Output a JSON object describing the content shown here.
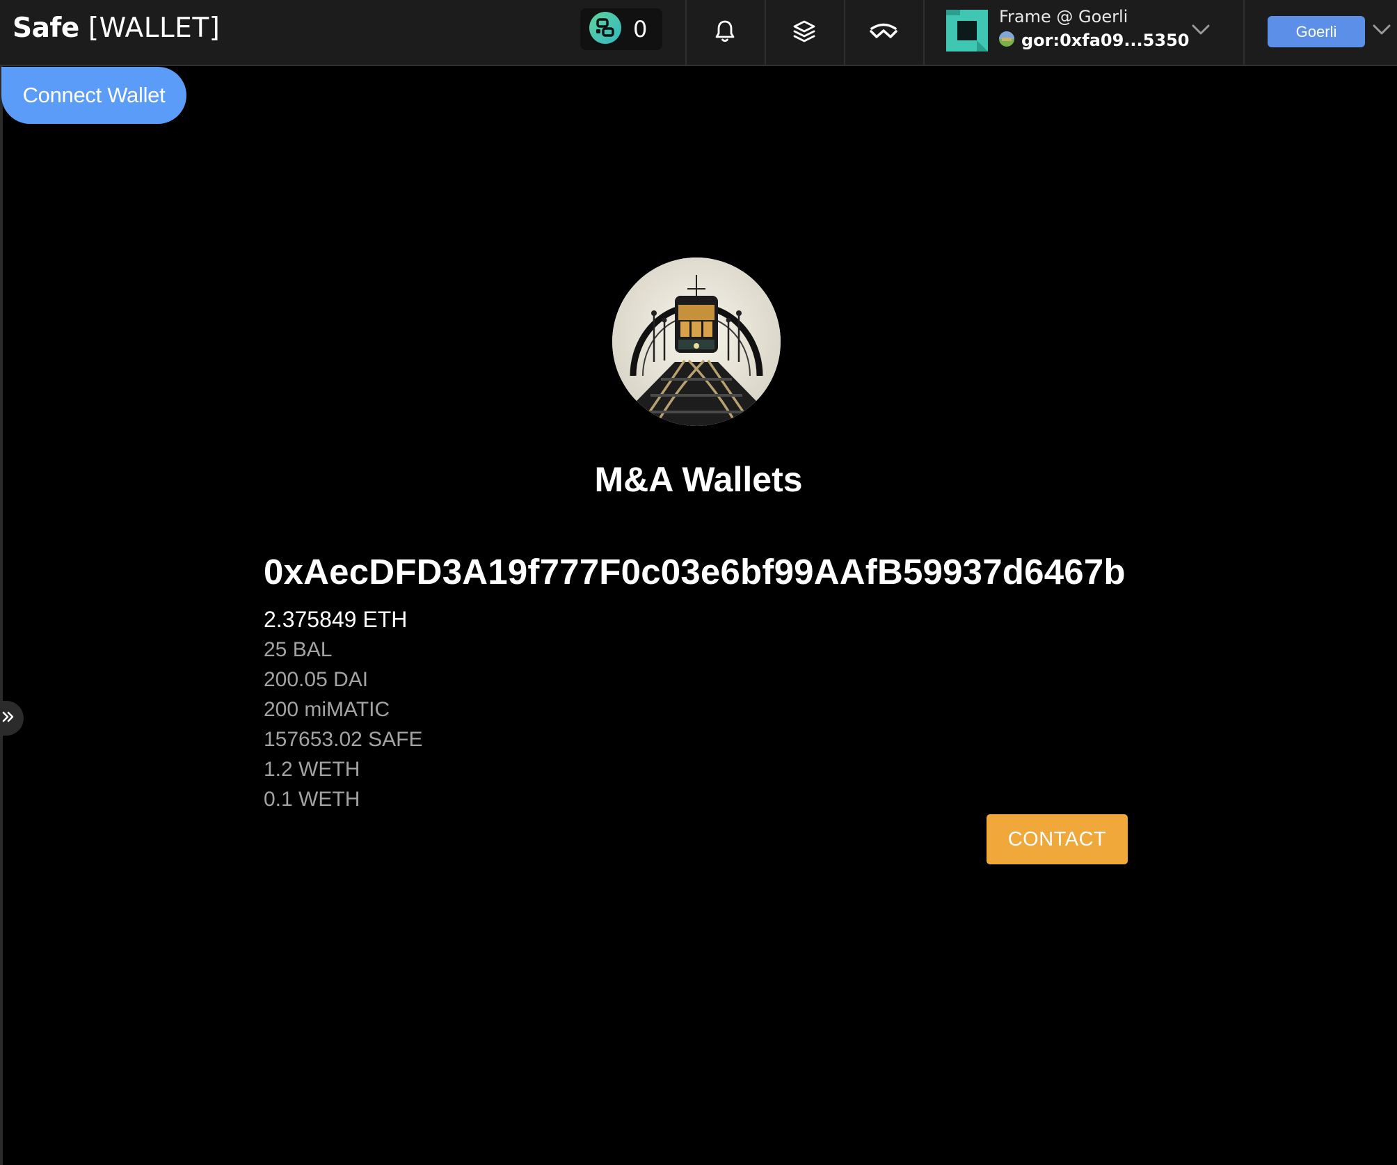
{
  "header": {
    "brand_main": "Safe",
    "brand_bracket": "[WALLET]",
    "pending_count": "0",
    "icons": [
      "safe-apps-icon",
      "bell-icon",
      "layers-icon",
      "walletconnect-icon",
      "chevron-down-icon"
    ],
    "account": {
      "name": "Frame @ Goerli",
      "address": "gor:0xfa09...5350"
    },
    "network": {
      "label": "Goerli",
      "color": "#5b8fe8"
    }
  },
  "connect": {
    "label": "Connect Wallet",
    "color": "#5a9cf8"
  },
  "wallet": {
    "name": "M&A Wallets",
    "address": "0xAecDFD3A19f777F0c03e6bf99AAfB59937d6467b",
    "eth_balance": "2.375849 ETH",
    "tokens": [
      "25 BAL",
      "200.05 DAI",
      "200 miMATIC",
      "157653.02 SAFE",
      "1.2 WETH",
      "0.1 WETH"
    ]
  },
  "contact": {
    "label": "CONTACT",
    "color": "#f0a83a"
  }
}
